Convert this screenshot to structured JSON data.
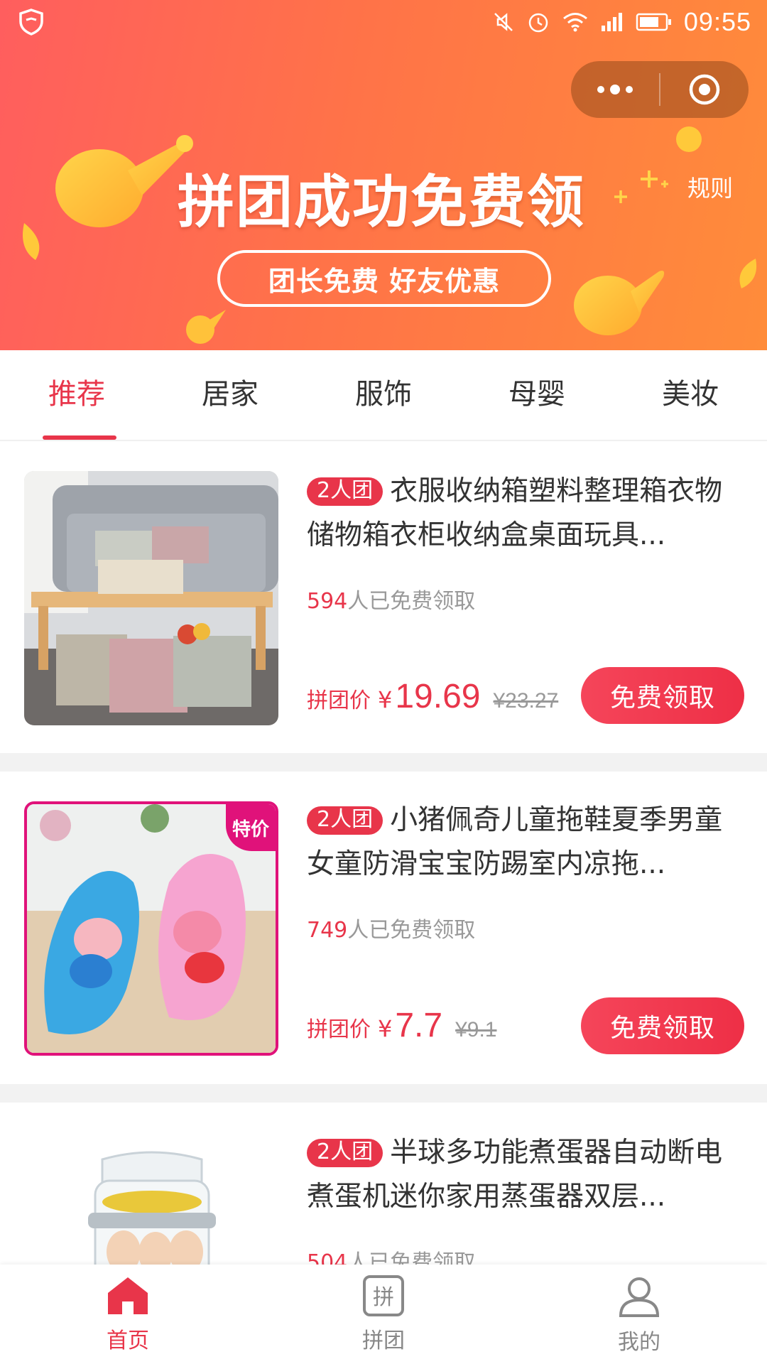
{
  "status_bar": {
    "time": "09:55"
  },
  "hero": {
    "title": "拼团成功免费领",
    "rules_label": "规则",
    "subtitle": "团长免费  好友优惠"
  },
  "tabs": [
    {
      "label": "推荐",
      "active": true
    },
    {
      "label": "居家",
      "active": false
    },
    {
      "label": "服饰",
      "active": false
    },
    {
      "label": "母婴",
      "active": false
    },
    {
      "label": "美妆",
      "active": false
    }
  ],
  "products": [
    {
      "badge": "2人团",
      "title": "衣服收纳箱塑料整理箱衣物储物箱衣柜收纳盒桌面玩具...",
      "claimed_count": "594",
      "claimed_suffix": "人已免费领取",
      "price_label": "拼团价",
      "currency": "¥",
      "price": "19.69",
      "original_price": "¥23.27",
      "button_label": "免费领取"
    },
    {
      "badge": "2人团",
      "title": "小猪佩奇儿童拖鞋夏季男童女童防滑宝宝防踢室内凉拖...",
      "claimed_count": "749",
      "claimed_suffix": "人已免费领取",
      "price_label": "拼团价",
      "currency": "¥",
      "price": "7.7",
      "original_price": "¥9.1",
      "button_label": "免费领取",
      "image_tag": "特价"
    },
    {
      "badge": "2人团",
      "title": "半球多功能煮蛋器自动断电煮蛋机迷你家用蒸蛋器双层...",
      "claimed_count": "504",
      "claimed_suffix": "人已免费领取"
    }
  ],
  "bottom_nav": [
    {
      "label": "首页",
      "icon": "home-icon",
      "active": true
    },
    {
      "label": "拼团",
      "icon": "group-buy-icon",
      "active": false
    },
    {
      "label": "我的",
      "icon": "profile-icon",
      "active": false
    }
  ],
  "colors": {
    "accent": "#e8354a",
    "hero_gradient_start": "#ff5e5e",
    "hero_gradient_end": "#ff8c3a",
    "muted_text": "#999999"
  }
}
